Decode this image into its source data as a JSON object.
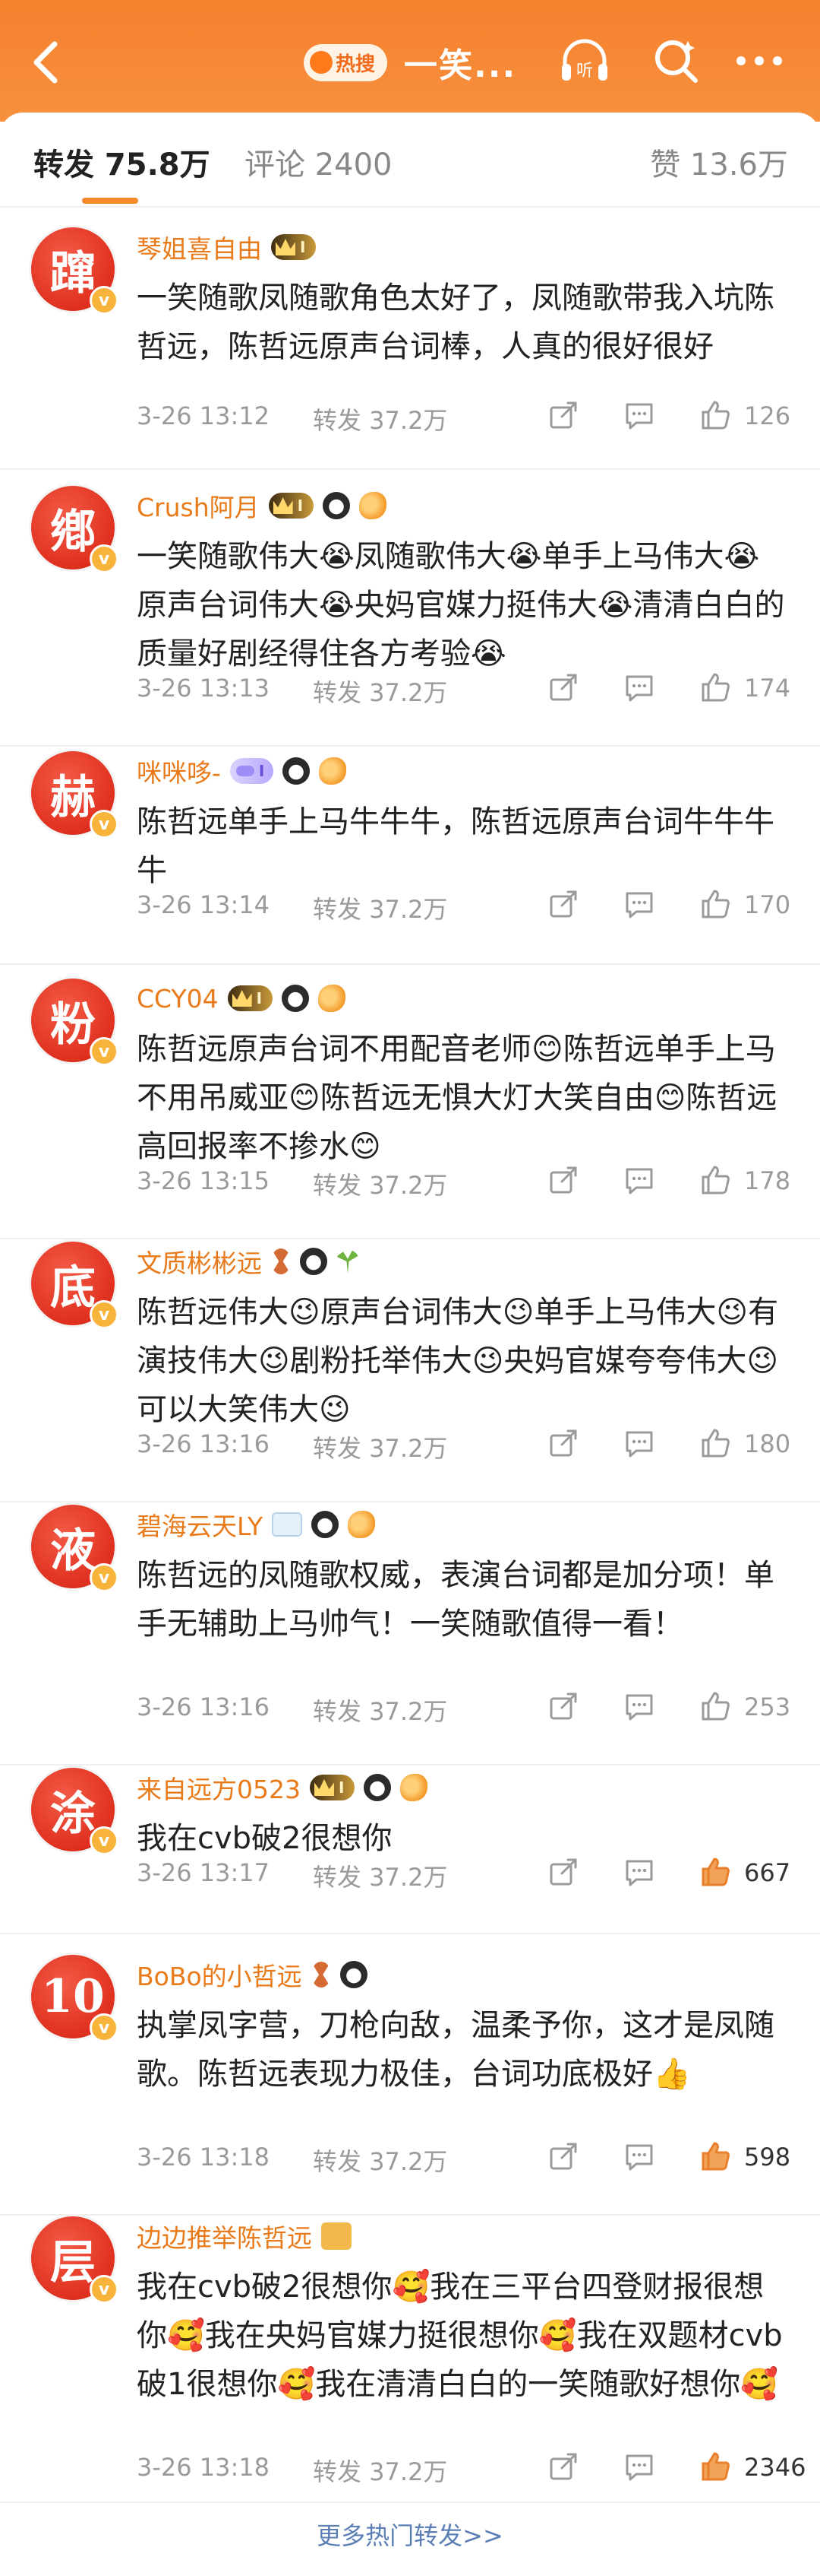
{
  "header": {
    "hot_label": "热搜",
    "title": "一笑...",
    "icons": [
      "back-icon",
      "listen-icon",
      "search-icon",
      "more-icon"
    ]
  },
  "tabs": {
    "repost": "转发 75.8万",
    "comment": "评论 2400",
    "like": "赞 13.6万"
  },
  "items": [
    {
      "avatar_char": "蹿",
      "name": "琴姐喜自由",
      "badges": [
        "crown-badge"
      ],
      "text": "一笑随歌凤随歌角色太好了，凤随歌带我入坑陈哲远，陈哲远原声台词棒，人真的很好很好",
      "time": "3-26 13:12",
      "repost": "转发 37.2万",
      "likes": "126"
    },
    {
      "avatar_char": "鄕",
      "name": "Crush阿月",
      "badges": [
        "crown-badge",
        "panda",
        "fish"
      ],
      "text": "一笑随歌伟大😭凤随歌伟大😭单手上马伟大😭原声台词伟大😭央妈官媒力挺伟大😭清清白白的质量好剧经得住各方考验😭",
      "time": "3-26 13:13",
      "repost": "转发 37.2万",
      "likes": "174"
    },
    {
      "avatar_char": "赫",
      "name": "咪咪哆-",
      "badges": [
        "lv-badge",
        "panda",
        "fish"
      ],
      "text": "陈哲远单手上马牛牛牛，陈哲远原声台词牛牛牛牛",
      "time": "3-26 13:14",
      "repost": "转发 37.2万",
      "likes": "170"
    },
    {
      "avatar_char": "粉",
      "name": "CCY04",
      "badges": [
        "crown-badge",
        "panda",
        "fish"
      ],
      "text": "陈哲远原声台词不用配音老师😊陈哲远单手上马不用吊威亚😊陈哲远无惧大灯大笑自由😊陈哲远高回报率不掺水😊",
      "time": "3-26 13:15",
      "repost": "转发 37.2万",
      "likes": "178"
    },
    {
      "avatar_char": "底",
      "name": "文质彬彬远",
      "badges": [
        "hourglass",
        "panda",
        "sprout"
      ],
      "text": "陈哲远伟大😉原声台词伟大😉单手上马伟大😉有演技伟大😉剧粉托举伟大😉央妈官媒夸夸伟大😉可以大笑伟大😉",
      "time": "3-26 13:16",
      "repost": "转发 37.2万",
      "likes": "180"
    },
    {
      "avatar_char": "液",
      "name": "碧海云天LY",
      "badges": [
        "light",
        "panda",
        "fish"
      ],
      "text": "陈哲远的凤随歌权威，表演台词都是加分项！单手无辅助上马帅气！一笑随歌值得一看！",
      "time": "3-26 13:16",
      "repost": "转发 37.2万",
      "likes": "253"
    },
    {
      "avatar_char": "涂",
      "name": "来自远方0523",
      "badges": [
        "crown-badge",
        "panda",
        "fish"
      ],
      "text": "我在cvb破2很想你",
      "time": "3-26 13:17",
      "repost": "转发 37.2万",
      "likes": "667"
    },
    {
      "avatar_char": "10",
      "name": "BoBo的小哲远",
      "badges": [
        "hourglass",
        "panda"
      ],
      "text": "执掌凤字营，刀枪向敌，温柔予你，这才是凤随歌。陈哲远表现力极佳，台词功底极好👍",
      "time": "3-26 13:18",
      "repost": "转发 37.2万",
      "likes": "598"
    },
    {
      "avatar_char": "层",
      "name": "边边推举陈哲远",
      "badges": [
        "gift"
      ],
      "text": "我在cvb破2很想你🥰我在三平台四登财报很想你🥰我在央妈官媒力挺很想你🥰我在双题材cvb破1很想你🥰我在清清白白的一笑随歌好想你🥰",
      "time": "3-26 13:18",
      "repost": "转发 37.2万",
      "likes": "2346"
    }
  ],
  "footer": {
    "more_link": "更多热门转发>>"
  },
  "colors": {
    "header_orange": "#f5802e",
    "username": "#e97a1a",
    "avatar_red": "#e0301f",
    "link_blue": "#5b7fb5"
  }
}
